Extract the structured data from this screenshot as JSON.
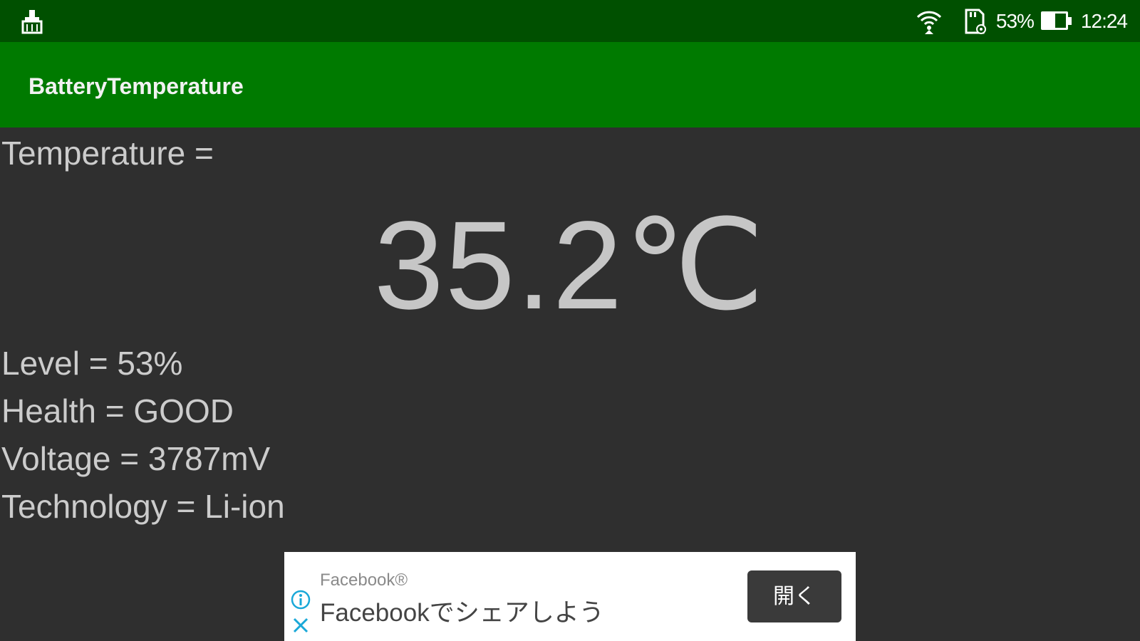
{
  "status_bar": {
    "notification_icon": "cleaner-icon",
    "wifi_icon": "wifi-icon",
    "sd_icon": "sd-card-icon",
    "battery_percent": "53%",
    "battery_level": 0.53,
    "time": "12:24"
  },
  "app_bar": {
    "title": "BatteryTemperature",
    "color": "#007a00"
  },
  "main": {
    "temperature_label": "Temperature =",
    "temperature_value": "35.2℃",
    "level": "Level = 53%",
    "health": "Health = GOOD",
    "voltage": "Voltage = 3787mV",
    "technology": "Technology = Li-ion"
  },
  "ad_banner": {
    "advertiser": "Facebook®",
    "headline": "Facebookでシェアしよう",
    "button_label": "開く",
    "info_icon": "info-icon",
    "close_icon": "close-icon"
  }
}
